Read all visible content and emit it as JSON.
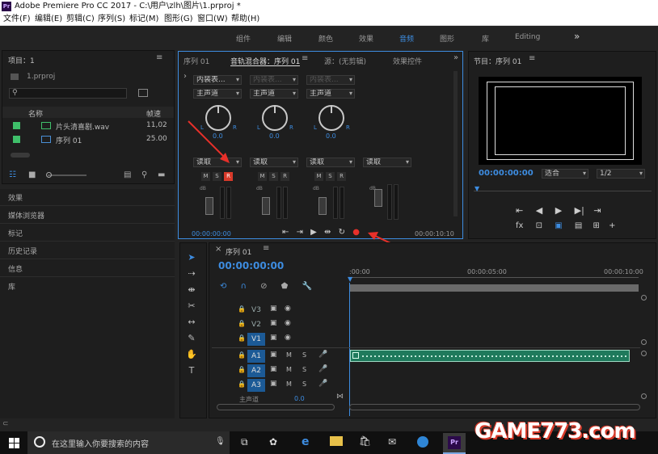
{
  "titlebar": {
    "icon": "Pr",
    "title": "Adobe Premiere Pro CC 2017 - C:\\用户\\zlh\\图片\\1.prproj *"
  },
  "menu": [
    "文件(F)",
    "编辑(E)",
    "剪辑(C)",
    "序列(S)",
    "标记(M)",
    "图形(G)",
    "窗口(W)",
    "帮助(H)"
  ],
  "workspaces": [
    "组件",
    "编辑",
    "颜色",
    "效果",
    "音频",
    "图形",
    "库",
    "Editing"
  ],
  "workspace_active": "音频",
  "project": {
    "title": "项目：1",
    "file": "1.prproj",
    "col_name": "名称",
    "col_rate": "帧速",
    "items": [
      {
        "name": "片头清喜剧.wav",
        "rate": "11,02",
        "color": "#3fbf6a"
      },
      {
        "name": "序列 01",
        "rate": "25.00",
        "color": "#3fbf6a"
      }
    ]
  },
  "side_panels": [
    "效果",
    "媒体浏览器",
    "标记",
    "历史记录",
    "信息",
    "库"
  ],
  "mixer": {
    "tabs": [
      "序列 01",
      "音轨混合器：序列 01",
      "源：(无剪辑)",
      "效果控件"
    ],
    "insert": "内装表...",
    "master": "主声道",
    "read": "读取",
    "pan": "0.0",
    "db": "dB",
    "timecode": "00:00:00:00",
    "duration": "00:00:10:10"
  },
  "tooltip": "录制",
  "program": {
    "title": "节目：序列 01",
    "timecode": "00:00:00:00",
    "fit": "适合",
    "res": "1/2"
  },
  "timeline": {
    "title": "序列 01",
    "timecode": "00:00:00:00",
    "ruler": [
      ":00:00",
      "00:00:05:00",
      "00:00:10:00"
    ],
    "video_tracks": [
      "V3",
      "V2",
      "V1"
    ],
    "audio_tracks": [
      "A1",
      "A2",
      "A3"
    ],
    "master": "主声道",
    "master_val": "0.0"
  },
  "taskbar": {
    "search": "在这里输入你要搜索的内容"
  },
  "watermark": "GAME773.com"
}
